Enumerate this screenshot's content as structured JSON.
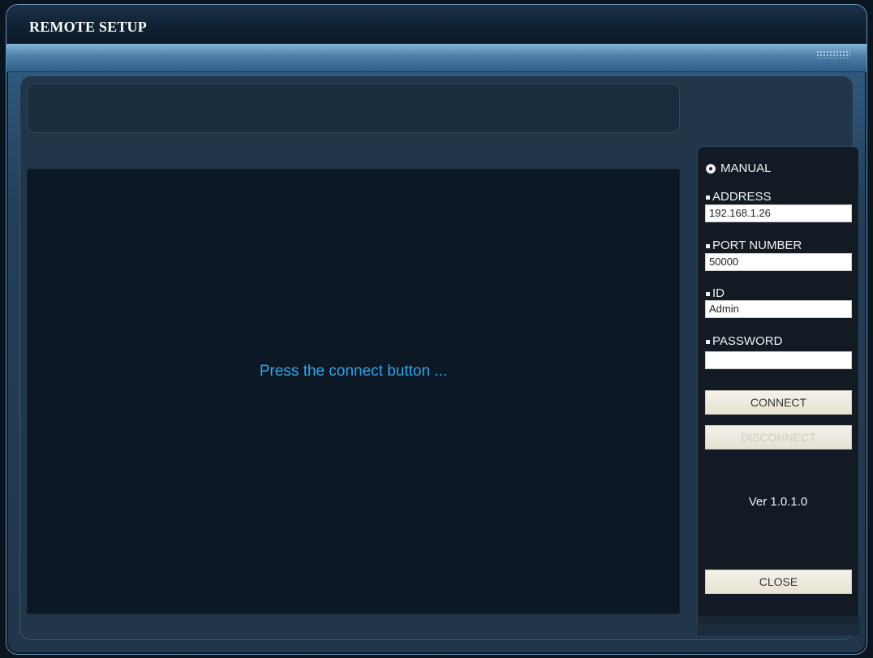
{
  "window": {
    "title": "REMOTE SETUP"
  },
  "main": {
    "status_text": "Press the connect button ..."
  },
  "sidebar": {
    "mode_label": "MANUAL",
    "address_label": "ADDRESS",
    "address_value": "192.168.1.26",
    "port_label": "PORT NUMBER",
    "port_value": "50000",
    "id_label": "ID",
    "id_value": "Admin",
    "password_label": "PASSWORD",
    "password_value": "",
    "connect_label": "CONNECT",
    "disconnect_label": "DISCONNECT",
    "version_text": "Ver 1.0.1.0",
    "close_label": "CLOSE"
  },
  "icons": {
    "radio": "radio-selected-icon",
    "bullet": "bullet-icon",
    "grip": "resize-grip-icon"
  },
  "colors": {
    "status_text": "#2ea6ec",
    "button_bg": "#ece6d8",
    "disabled_text": "#d1cbbd"
  }
}
